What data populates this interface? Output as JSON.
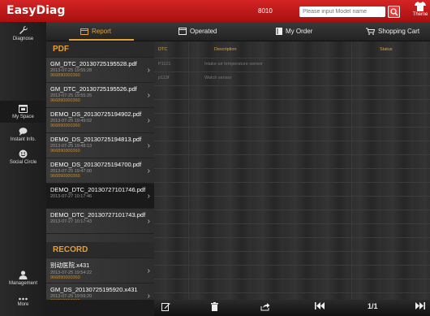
{
  "header": {
    "brand": "EasyDiag",
    "code": "8010",
    "search_placeholder": "Please input Model name",
    "theme_label": "Theme"
  },
  "nav": {
    "items": [
      {
        "label": "Diagnose",
        "icon": "wrench-icon"
      },
      {
        "label": "My Space",
        "icon": "calendar-icon"
      },
      {
        "label": "Instant Info.",
        "icon": "chat-icon"
      },
      {
        "label": "Social Circle",
        "icon": "smile-icon"
      },
      {
        "label": "Management",
        "icon": "person-icon"
      },
      {
        "label": "More",
        "icon": "ellipsis-icon"
      }
    ]
  },
  "tabs": [
    {
      "label": "Report",
      "icon": "report-icon",
      "active": true
    },
    {
      "label": "Operated",
      "icon": "tray-icon",
      "active": false
    },
    {
      "label": "My Order",
      "icon": "book-icon",
      "active": false
    },
    {
      "label": "Shopping Cart",
      "icon": "cart-icon",
      "active": false
    }
  ],
  "files": {
    "pdf_header": "PDF",
    "pdf": [
      {
        "name": "GM_DTC_20130725195528.pdf",
        "date": "2013-07-25 19:55:28",
        "id": "966890000360"
      },
      {
        "name": "GM_DTC_20130725195526.pdf",
        "date": "2013-07-25 19:55:26",
        "id": "966890000360"
      },
      {
        "name": "DEMO_DS_20130725194902.pdf",
        "date": "2013-07-25 19:49:02",
        "id": "966890000360"
      },
      {
        "name": "DEMO_DS_20130725194813.pdf",
        "date": "2013-07-25 19:48:13",
        "id": "966890000360"
      },
      {
        "name": "DEMO_DS_20130725194700.pdf",
        "date": "2013-07-25 19:47:00",
        "id": "966890000360"
      },
      {
        "name": "DEMO_DTC_20130727101746.pdf",
        "date": "2013-07-27 10:17:46",
        "id": ""
      },
      {
        "name": "DEMO_DTC_20130727101743.pdf",
        "date": "2013-07-27 10:17:43",
        "id": ""
      }
    ],
    "record_header": "RECORD",
    "record": [
      {
        "name": "别动医院.x431",
        "date": "2013-07-25 19:54:22",
        "id": "966890000360"
      },
      {
        "name": "GM_DS_20130725195920.x431",
        "date": "2013-07-25 19:59:20",
        "id": "966890000360"
      }
    ]
  },
  "table": {
    "headers": {
      "dtc": "DTC",
      "description": "Description",
      "status": "Status"
    },
    "rows": [
      {
        "dtc": "P1121",
        "description": "Intake air temperature sensor",
        "status": ""
      },
      {
        "dtc": "p113f",
        "description": "Watch sensor",
        "status": ""
      }
    ]
  },
  "bottombar": {
    "page": "1/1"
  }
}
